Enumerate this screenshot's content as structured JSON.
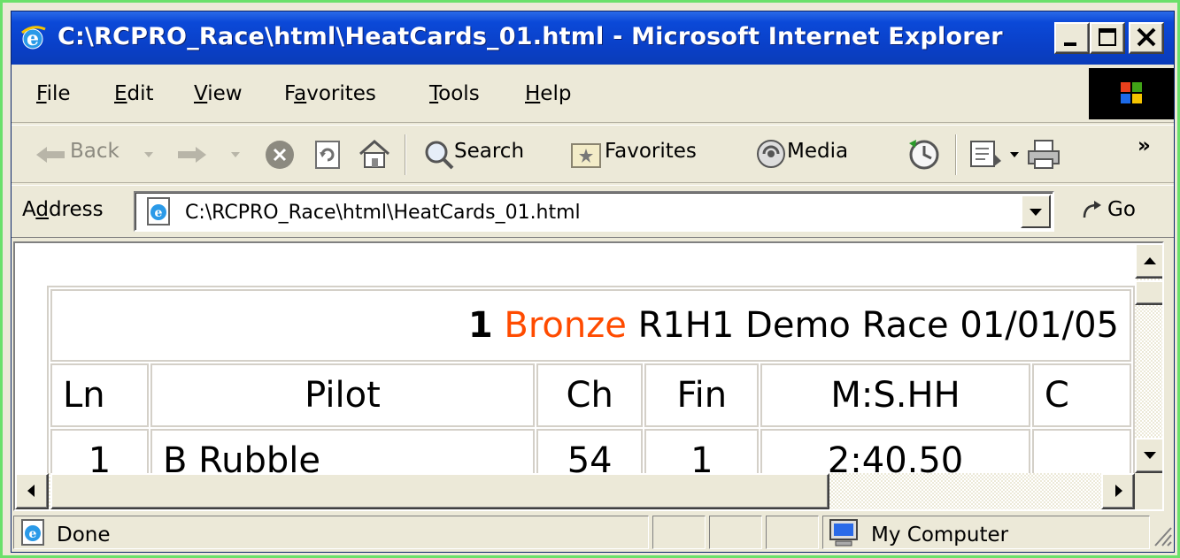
{
  "window": {
    "title": "C:\\RCPRO_Race\\html\\HeatCards_01.html - Microsoft Internet Explorer"
  },
  "menu": {
    "items": [
      {
        "label": "File",
        "accel": "F",
        "rest": "ile"
      },
      {
        "label": "Edit",
        "accel": "E",
        "rest": "dit"
      },
      {
        "label": "View",
        "accel": "V",
        "rest": "iew"
      },
      {
        "label": "Favorites",
        "pre": "F",
        "accel": "a",
        "rest": "vorites"
      },
      {
        "label": "Tools",
        "accel": "T",
        "rest": "ools"
      },
      {
        "label": "Help",
        "accel": "H",
        "rest": "elp"
      }
    ]
  },
  "toolbar": {
    "back": "Back",
    "search": "Search",
    "favorites": "Favorites",
    "media": "Media",
    "more": "»"
  },
  "address": {
    "label_pre": "A",
    "label_accel": "d",
    "label_rest": "dress",
    "url": "C:\\RCPRO_Race\\html\\HeatCards_01.html",
    "go": "Go"
  },
  "heat": {
    "number": "1",
    "level": "Bronze",
    "rest": "R1H1 Demo Race 01/01/05",
    "columns": [
      "Ln",
      "Pilot",
      "Ch",
      "Fin",
      "M:S.HH",
      "C"
    ],
    "rows": [
      [
        "1",
        "B Rubble",
        "54",
        "1",
        "2:40.50",
        ""
      ]
    ]
  },
  "status": {
    "text": "Done",
    "zone": "My Computer"
  },
  "colors": {
    "titlebar": "#0a3fc6",
    "level": "#ff4b00",
    "frame": "#6ae06a"
  }
}
